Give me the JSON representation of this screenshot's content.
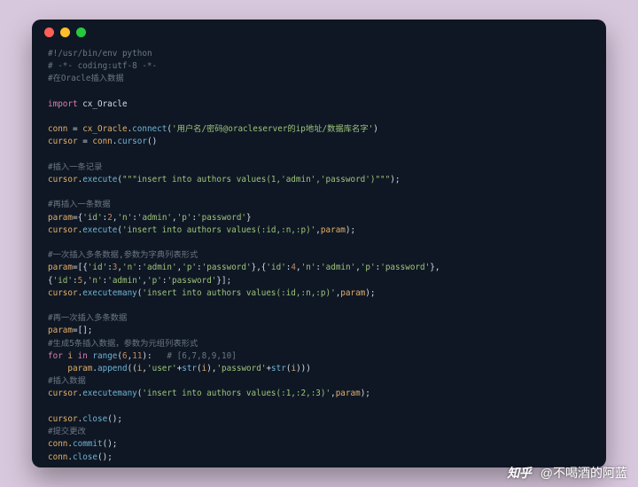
{
  "window": {
    "dots": [
      "red",
      "yellow",
      "green"
    ]
  },
  "code": {
    "l1": "#!/usr/bin/env python",
    "l2": "# -*- coding:utf-8 -*-",
    "l3": "#在Oracle插入数据",
    "l4": "",
    "l5_kw": "import",
    "l5_mod": " cx_Oracle",
    "l6": "",
    "l7_v1": "conn",
    "l7_e": " = ",
    "l7_v2": "cx_Oracle",
    "l7_d": ".",
    "l7_f": "connect",
    "l7_p1": "(",
    "l7_s": "'用户名/密码@oracleserver的ip地址/数据库名字'",
    "l7_p2": ")",
    "l8_v1": "cursor",
    "l8_e": " = ",
    "l8_v2": "conn",
    "l8_d": ".",
    "l8_f": "cursor",
    "l8_p": "()",
    "l9": "",
    "c1": "#插入一条记录",
    "l11_v": "cursor",
    "l11_d": ".",
    "l11_f": "execute",
    "l11_p1": "(",
    "l11_s": "\"\"\"insert into authors values(1,'admin','password')\"\"\"",
    "l11_p2": ");",
    "l12": "",
    "c2": "#再插入一条数据",
    "l14_v": "param",
    "l14_e": "=",
    "l14_b1": "{",
    "l14_k1": "'id'",
    "l14_c1": ":",
    "l14_n1": "2",
    "l14_cm1": ",",
    "l14_k2": "'n'",
    "l14_c2": ":",
    "l14_s2": "'admin'",
    "l14_cm2": ",",
    "l14_k3": "'p'",
    "l14_c3": ":",
    "l14_s3": "'password'",
    "l14_b2": "}",
    "l15_v": "cursor",
    "l15_d": ".",
    "l15_f": "execute",
    "l15_p1": "(",
    "l15_s": "'insert into authors values(:id,:n,:p)'",
    "l15_cm": ",",
    "l15_v2": "param",
    "l15_p2": ");",
    "l16": "",
    "c3": "#一次插入多条数据,参数为字典列表形式",
    "l18_v": "param",
    "l18_e": "=[{",
    "l18_s1": "'id'",
    "l18_c1": ":",
    "l18_n1": "3",
    "l18_cm1": ",",
    "l18_s2": "'n'",
    "l18_c2": ":",
    "l18_s3": "'admin'",
    "l18_cm2": ",",
    "l18_s4": "'p'",
    "l18_c3": ":",
    "l18_s5": "'password'",
    "l18_b1": "},{",
    "l18_s6": "'id'",
    "l18_c4": ":",
    "l18_n2": "4",
    "l18_cm3": ",",
    "l18_s7": "'n'",
    "l18_c5": ":",
    "l18_s8": "'admin'",
    "l18_cm4": ",",
    "l18_s9": "'p'",
    "l18_c6": ":",
    "l18_s10": "'password'",
    "l18_b2": "},",
    "l19_b1": "{",
    "l19_s1": "'id'",
    "l19_c1": ":",
    "l19_n1": "5",
    "l19_cm1": ",",
    "l19_s2": "'n'",
    "l19_c2": ":",
    "l19_s3": "'admin'",
    "l19_cm2": ",",
    "l19_s4": "'p'",
    "l19_c3": ":",
    "l19_s5": "'password'",
    "l19_b2": "}];",
    "l20_v": "cursor",
    "l20_d": ".",
    "l20_f": "executemany",
    "l20_p1": "(",
    "l20_s": "'insert into authors values(:id,:n,:p)'",
    "l20_cm": ",",
    "l20_v2": "param",
    "l20_p2": ");",
    "l21": "",
    "c4": "#再一次插入多条数据",
    "l23_v": "param",
    "l23_e": "=[];",
    "c5": "#生成5条插入数据，参数为元组列表形式",
    "l25_for": "for",
    "l25_i": " i ",
    "l25_in": "in",
    "l25_sp": " ",
    "l25_f": "range",
    "l25_p1": "(",
    "l25_n1": "6",
    "l25_cm": ",",
    "l25_n2": "11",
    "l25_p2": "):",
    "l25_cmt": "   # [6,7,8,9,10]",
    "l26_ind": "    ",
    "l26_v": "param",
    "l26_d": ".",
    "l26_f": "append",
    "l26_p1": "((",
    "l26_i": "i",
    "l26_cm1": ",",
    "l26_s1": "'user'",
    "l26_plus1": "+",
    "l26_str1": "str",
    "l26_pp1": "(",
    "l26_i2": "i",
    "l26_pp2": ")",
    "l26_cm2": ",",
    "l26_s2": "'password'",
    "l26_plus2": "+",
    "l26_str2": "str",
    "l26_pp3": "(",
    "l26_i3": "i",
    "l26_pp4": ")))",
    "c6": "#插入数据",
    "l28_v": "cursor",
    "l28_d": ".",
    "l28_f": "executemany",
    "l28_p1": "(",
    "l28_s": "'insert into authors values(:1,:2,:3)'",
    "l28_cm": ",",
    "l28_v2": "param",
    "l28_p2": ");",
    "l29": "",
    "l30_v": "cursor",
    "l30_d": ".",
    "l30_f": "close",
    "l30_p": "();",
    "c7": "#提交更改",
    "l32_v": "conn",
    "l32_d": ".",
    "l32_f": "commit",
    "l32_p": "();",
    "l33_v": "conn",
    "l33_d": ".",
    "l33_f": "close",
    "l33_p": "();"
  },
  "watermark": {
    "logo": "知乎",
    "text": "@不喝酒的阿蓝"
  }
}
